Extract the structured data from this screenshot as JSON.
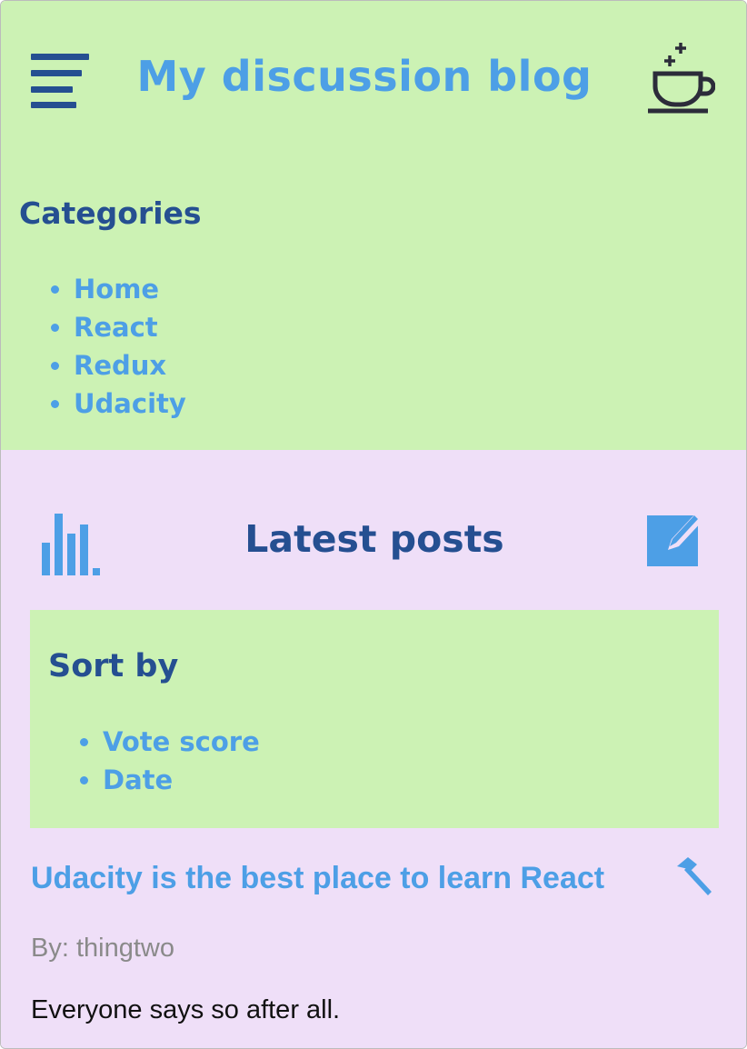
{
  "header": {
    "title": "My discussion blog",
    "menu_icon": "hamburger-menu-icon",
    "coffee_icon": "coffee-cup-icon"
  },
  "categories": {
    "heading": "Categories",
    "items": [
      "Home",
      "React",
      "Redux",
      "Udacity"
    ]
  },
  "main": {
    "heading": "Latest posts",
    "chart_icon": "bar-chart-icon",
    "edit_icon": "edit-square-icon",
    "sort": {
      "heading": "Sort by",
      "options": [
        "Vote score",
        "Date"
      ]
    },
    "posts": [
      {
        "title": "Udacity is the best place to learn React",
        "author": "By: thingtwo",
        "body": "Everyone says so after all.",
        "action_icon": "hammer-icon"
      }
    ]
  },
  "colors": {
    "header_bg": "#ccf2b4",
    "main_bg": "#efdff8",
    "accent_blue": "#4d9fe6",
    "dark_blue": "#254f91",
    "muted_text": "#8a8a8a"
  }
}
